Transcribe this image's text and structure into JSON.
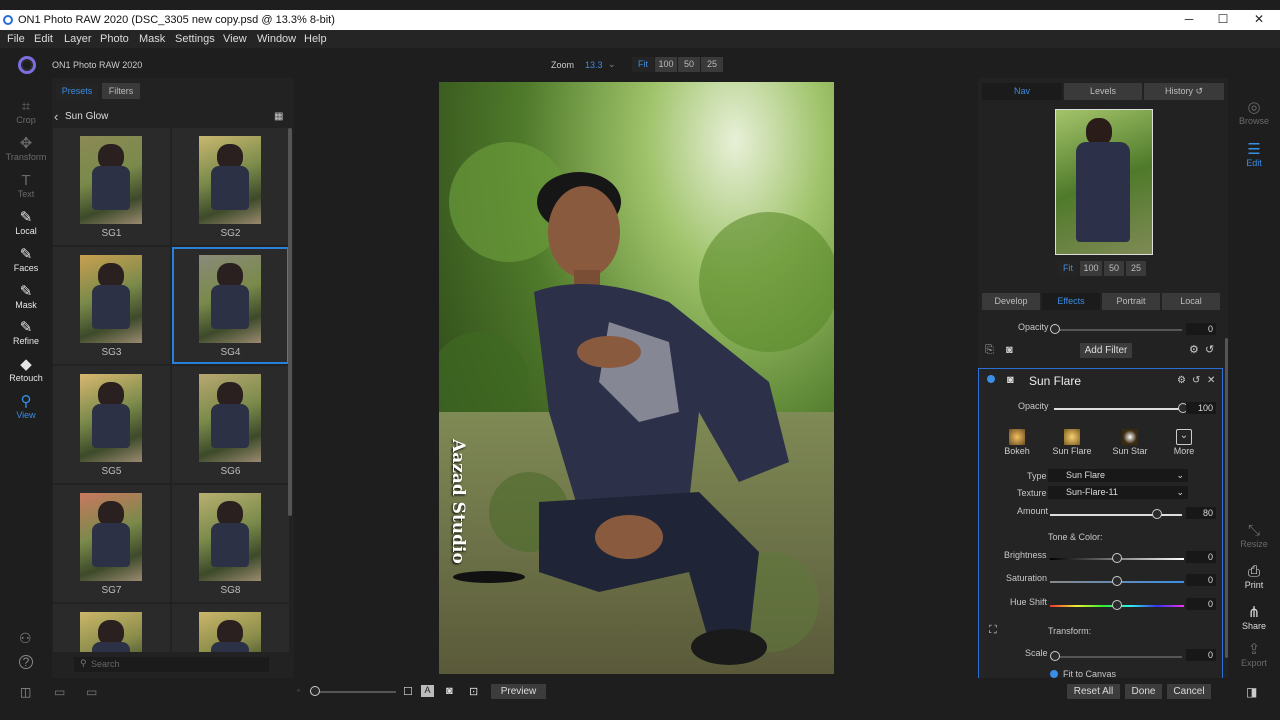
{
  "window": {
    "title": "ON1 Photo RAW 2020 (DSC_3305 new copy.psd @ 13.3% 8-bit)",
    "min": "─",
    "max": "☐",
    "close": "✕"
  },
  "menu": [
    "File",
    "Edit",
    "Layer",
    "Photo",
    "Mask",
    "Settings",
    "View",
    "Window",
    "Help"
  ],
  "app_name": "ON1 Photo RAW 2020",
  "zoom": {
    "label": "Zoom",
    "value": "13.3",
    "buttons": [
      "Fit",
      "100",
      "50",
      "25"
    ]
  },
  "tools": [
    {
      "label": "Crop",
      "icon": "crop-icon",
      "glyph": "⌗"
    },
    {
      "label": "Transform",
      "icon": "transform-icon",
      "glyph": "✥"
    },
    {
      "label": "Text",
      "icon": "text-icon",
      "glyph": "T"
    },
    {
      "label": "Local",
      "icon": "local-brush-icon",
      "glyph": "✎"
    },
    {
      "label": "Faces",
      "icon": "faces-icon",
      "glyph": "✎"
    },
    {
      "label": "Mask",
      "icon": "mask-icon",
      "glyph": "✎"
    },
    {
      "label": "Refine",
      "icon": "refine-icon",
      "glyph": "✎"
    },
    {
      "label": "Retouch",
      "icon": "retouch-icon",
      "glyph": "◆"
    },
    {
      "label": "View",
      "icon": "view-icon",
      "glyph": "⚲"
    }
  ],
  "presets_panel": {
    "tabs": [
      "Presets",
      "Filters"
    ],
    "category": "Sun Glow",
    "thumbs": [
      "SG1",
      "SG2",
      "SG3",
      "SG4",
      "SG5",
      "SG6",
      "SG7",
      "SG8"
    ],
    "selected": "SG4",
    "search_placeholder": "Search"
  },
  "photo": {
    "watermark": "Aazad Studio"
  },
  "right_panel": {
    "top_tabs": [
      "Nav",
      "Levels",
      "History"
    ],
    "history_icon": "↺",
    "nav_zoom": [
      "Fit",
      "100",
      "50",
      "25"
    ],
    "module_tabs": [
      "Develop",
      "Effects",
      "Portrait",
      "Local"
    ],
    "opacity_label": "Opacity",
    "opacity_value": "0",
    "add_filter": "Add Filter",
    "filter": {
      "name": "Sun Flare",
      "opacity_label": "Opacity",
      "opacity_value": "100",
      "presets": [
        "Bokeh",
        "Sun Flare",
        "Sun Star",
        "More"
      ],
      "type_label": "Type",
      "type_value": "Sun Flare",
      "texture_label": "Texture",
      "texture_value": "Sun-Flare-11",
      "amount_label": "Amount",
      "amount_value": "80",
      "tone_header": "Tone & Color:",
      "brightness_label": "Brightness",
      "brightness_value": "0",
      "saturation_label": "Saturation",
      "saturation_value": "0",
      "hue_label": "Hue Shift",
      "hue_value": "0",
      "transform_header": "Transform:",
      "scale_label": "Scale",
      "scale_value": "0",
      "fit_canvas": "Fit to Canvas"
    }
  },
  "right_icons": [
    {
      "label": "Browse",
      "icon": "browse-icon",
      "glyph": "◎"
    },
    {
      "label": "Edit",
      "icon": "edit-sliders-icon",
      "glyph": "☰"
    },
    {
      "label": "Resize",
      "icon": "resize-icon",
      "glyph": "⤡"
    },
    {
      "label": "Print",
      "icon": "print-icon",
      "glyph": "⎙"
    },
    {
      "label": "Share",
      "icon": "share-icon",
      "glyph": "⋔"
    },
    {
      "label": "Export",
      "icon": "export-icon",
      "glyph": "⇪"
    }
  ],
  "bottom": {
    "preview": "Preview",
    "reset_all": "Reset All",
    "done": "Done",
    "cancel": "Cancel"
  },
  "colors": {
    "accent": "#2a7fd8",
    "bg": "#1e1e1e",
    "panel": "#222222"
  }
}
